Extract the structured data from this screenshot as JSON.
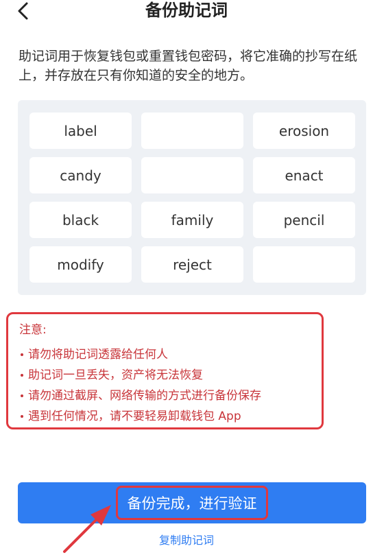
{
  "header": {
    "title": "备份助记词",
    "back_icon": "chevron-left-icon"
  },
  "description": "助记词用于恢复钱包或重置钱包密码，将它准确的抄写在纸上，并存放在只有你知道的安全的地方。",
  "mnemonic": {
    "words": [
      "label",
      "",
      "erosion",
      "candy",
      "",
      "enact",
      "black",
      "family",
      "pencil",
      "modify",
      "reject",
      ""
    ]
  },
  "notice": {
    "title": "注意:",
    "items": [
      "请勿将助记词透露给任何人",
      "助记词一旦丢失，资产将无法恢复",
      "请勿通过截屏、网络传输的方式进行备份保存",
      "遇到任何情况，请不要轻易卸载钱包 App"
    ]
  },
  "actions": {
    "confirm_label": "备份完成，进行验证",
    "copy_label": "复制助记词"
  },
  "colors": {
    "accent": "#2f7df2",
    "warning": "#c8353a",
    "highlight": "#e0383e",
    "grid_background": "#eef1f5"
  }
}
